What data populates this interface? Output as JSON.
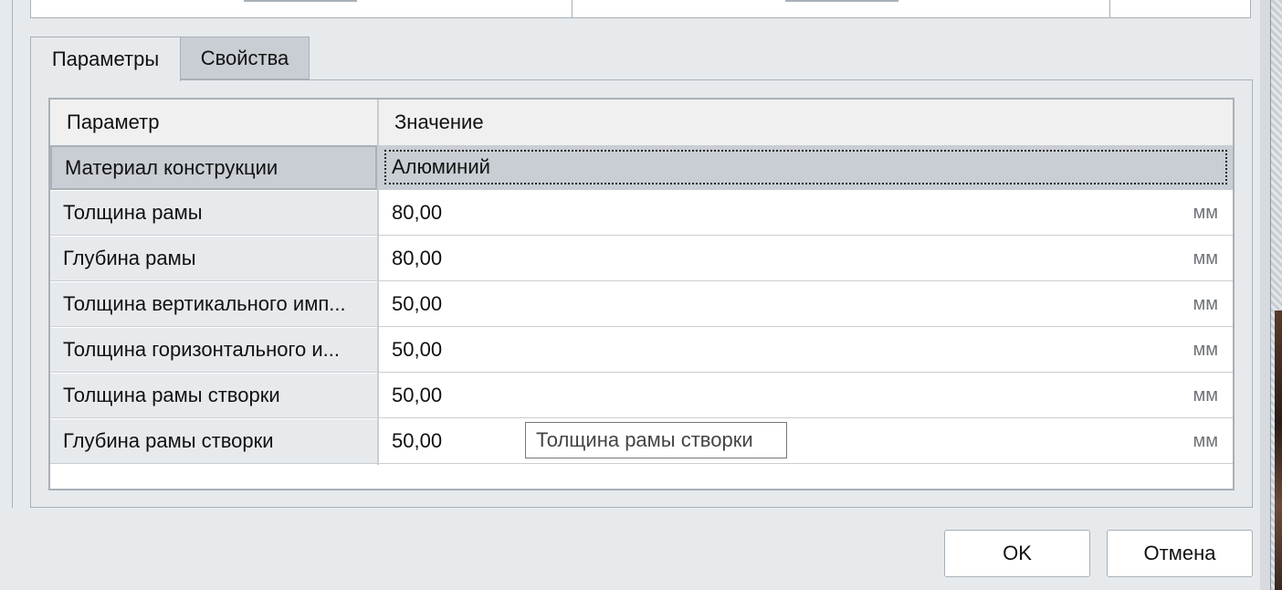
{
  "tabs": [
    {
      "label": "Параметры",
      "active": true
    },
    {
      "label": "Свойства",
      "active": false
    }
  ],
  "grid": {
    "columns": [
      "Параметр",
      "Значение"
    ],
    "rows": [
      {
        "name": "Материал конструкции",
        "value": "Алюминий",
        "unit": ""
      },
      {
        "name": "Толщина рамы",
        "value": "80,00",
        "unit": "мм"
      },
      {
        "name": "Глубина рамы",
        "value": "80,00",
        "unit": "мм"
      },
      {
        "name": "Толщина вертикального имп...",
        "value": "50,00",
        "unit": "мм"
      },
      {
        "name": "Толщина горизонтального и...",
        "value": "50,00",
        "unit": "мм"
      },
      {
        "name": "Толщина рамы створки",
        "value": "50,00",
        "unit": "мм"
      },
      {
        "name": "Глубина рамы створки",
        "value": "50,00",
        "unit": "мм"
      }
    ]
  },
  "tooltip": "Толщина рамы створки",
  "buttons": {
    "ok": "OK",
    "cancel": "Отмена"
  }
}
